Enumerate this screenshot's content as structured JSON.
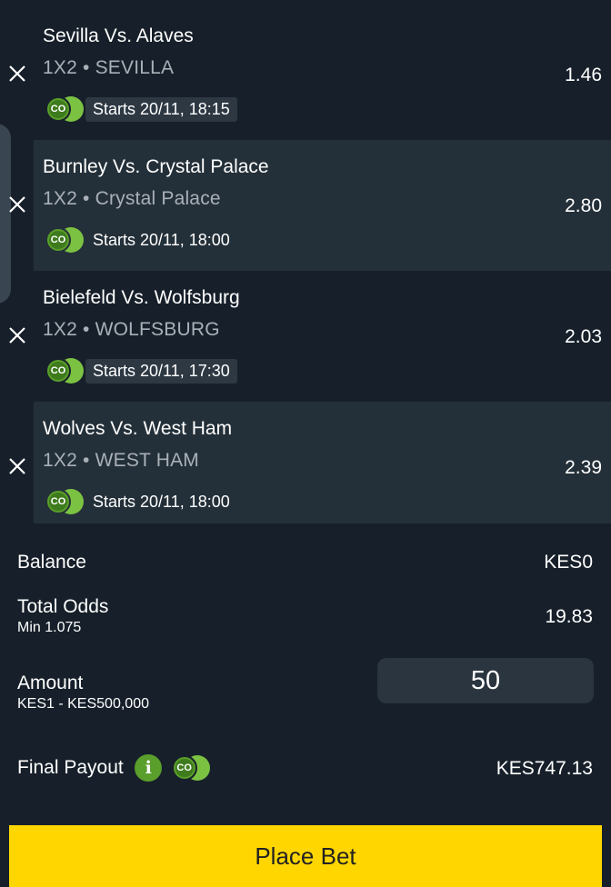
{
  "bets": [
    {
      "match": "Sevilla Vs. Alaves",
      "market": "1X2 • SEVILLA",
      "odds": "1.46",
      "start": "Starts 20/11, 18:15",
      "badge": "CO"
    },
    {
      "match": "Burnley Vs. Crystal Palace",
      "market": "1X2 • Crystal Palace",
      "odds": "2.80",
      "start": "Starts 20/11, 18:00",
      "badge": "CO"
    },
    {
      "match": "Bielefeld Vs. Wolfsburg",
      "market": "1X2 • WOLFSBURG",
      "odds": "2.03",
      "start": "Starts 20/11, 17:30",
      "badge": "CO"
    },
    {
      "match": "Wolves Vs. West Ham",
      "market": "1X2 • WEST HAM",
      "odds": "2.39",
      "start": "Starts 20/11, 18:00",
      "badge": "CO"
    }
  ],
  "summary": {
    "balance_label": "Balance",
    "balance_value": "KES0",
    "total_odds_label": "Total Odds",
    "total_odds_min": "Min 1.075",
    "total_odds_value": "19.83",
    "amount_label": "Amount",
    "amount_range": "KES1 - KES500,000",
    "amount_value": "50",
    "final_payout_label": "Final Payout",
    "info_glyph": "i",
    "payout_badge": "CO",
    "final_payout_value": "KES747.13"
  },
  "place_bet_label": "Place Bet",
  "colors": {
    "background": "#17202a",
    "card_alt": "#243039",
    "accent_green": "#7cc242",
    "button_yellow": "#ffd600"
  }
}
